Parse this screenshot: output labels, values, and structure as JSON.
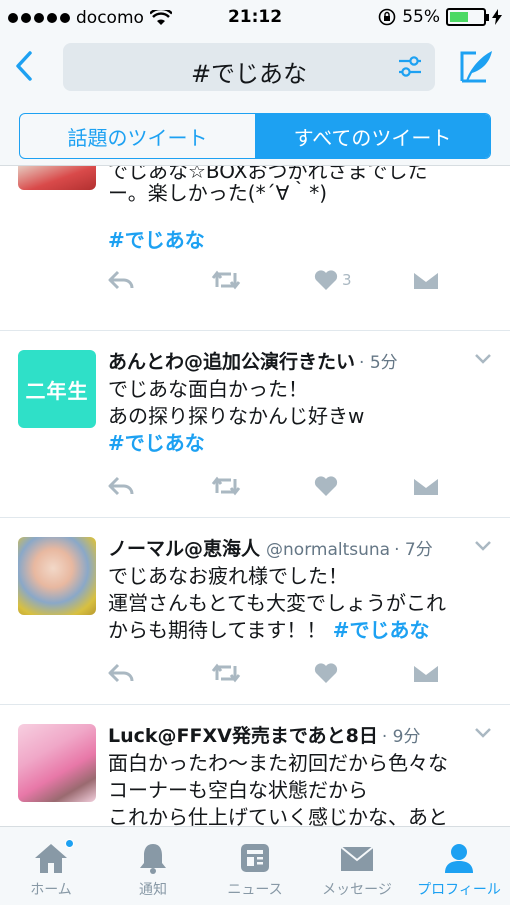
{
  "status_bar": {
    "carrier": "docomo",
    "time": "21:12",
    "battery": "55%",
    "battery_level": 0.55
  },
  "header": {
    "search_query": "#でじあな"
  },
  "segments": [
    {
      "label": "話題のツイート",
      "active": false
    },
    {
      "label": "すべてのツイート",
      "active": true
    }
  ],
  "tweets": [
    {
      "partial_text": "でじあな☆BOXおつかれさまでした",
      "text_line2": "ー。楽しかった(*´∀｀*)",
      "hashtag": "#でじあな",
      "likes": "3"
    },
    {
      "name": "あんとわ@追加公演行きたい",
      "time": "· 5分",
      "avatar_text": "二年生",
      "text_line1": "でじあな面白かった！",
      "text_line2": "あの探り探りなかんじ好きw",
      "hashtag": "#でじあな"
    },
    {
      "name": "ノーマル@恵海人",
      "handle": "@normaltsuna",
      "time": "· 7分",
      "text_line1": "でじあなお疲れ様でした！",
      "text_line2": "運営さんもとても大変でしょうがこれ",
      "text_line3": "からも期待してます！！",
      "hashtag": "#でじあな"
    },
    {
      "name": "Luck@FFXV発売まであと8日",
      "time": "· 9分",
      "text_line1": "面白かったわ〜また初回だから色々な",
      "text_line2": "コーナーも空白な状態だから",
      "text_line3": "これから仕上げていく感じかな、あと"
    }
  ],
  "tabbar": [
    {
      "label": "ホーム",
      "icon": "home-icon",
      "active": false
    },
    {
      "label": "通知",
      "icon": "bell-icon",
      "active": false
    },
    {
      "label": "ニュース",
      "icon": "news-icon",
      "active": false
    },
    {
      "label": "メッセージ",
      "icon": "mail-icon",
      "active": false
    },
    {
      "label": "プロフィール",
      "icon": "profile-icon",
      "active": true
    }
  ],
  "colors": {
    "accent": "#1da1f2",
    "icon_gray": "#aab8c2",
    "text_gray": "#657786"
  }
}
